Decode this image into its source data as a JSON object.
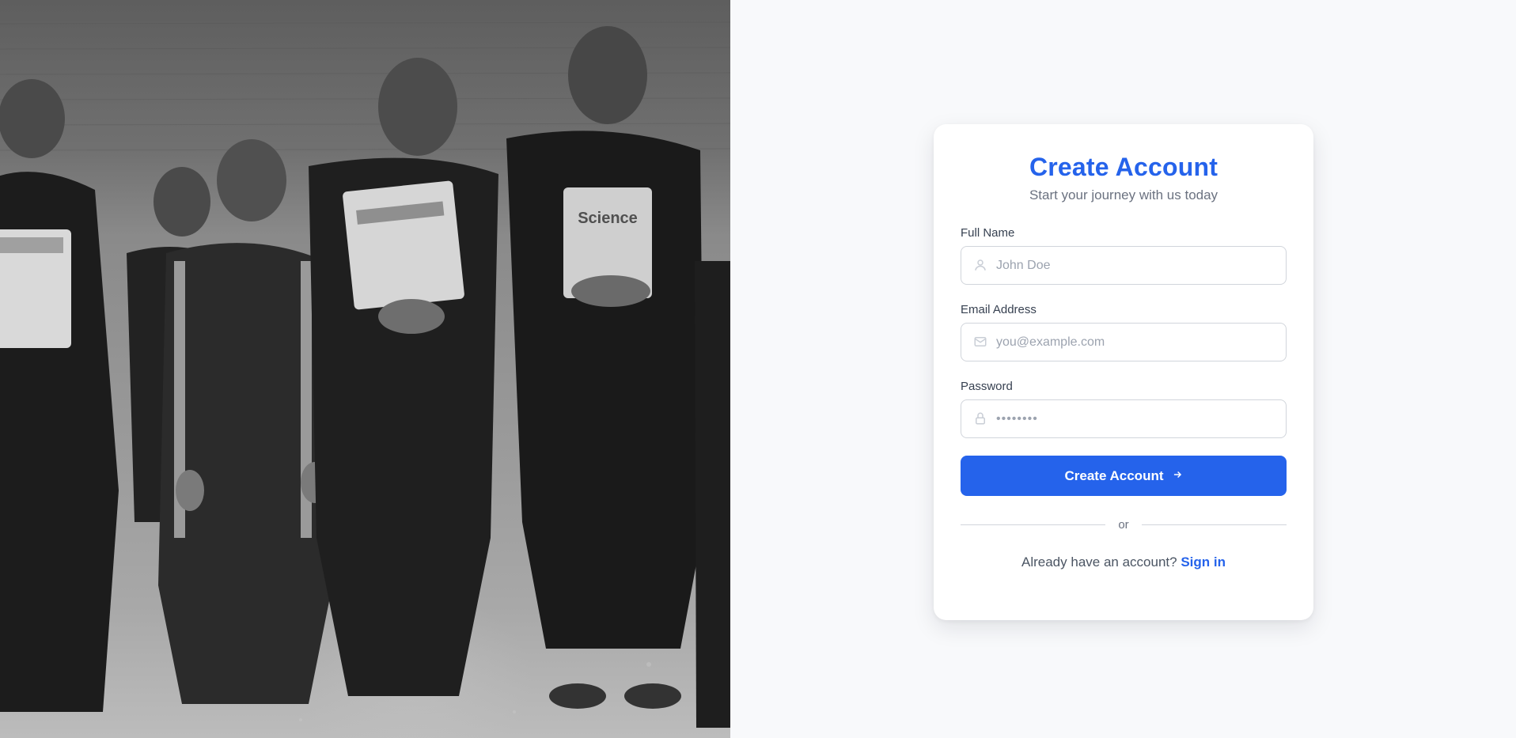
{
  "hero": {
    "image_subject": "black-and-white photograph of boys in traditional clothing holding books",
    "book_label": "Science"
  },
  "form": {
    "title": "Create Account",
    "subtitle": "Start your journey with us today",
    "fields": {
      "full_name": {
        "label": "Full Name",
        "placeholder": "John Doe",
        "icon": "user-icon"
      },
      "email": {
        "label": "Email Address",
        "placeholder": "you@example.com",
        "icon": "mail-icon"
      },
      "password": {
        "label": "Password",
        "placeholder": "••••••••",
        "icon": "lock-icon"
      }
    },
    "submit_label": "Create Account",
    "submit_icon": "arrow-right-icon",
    "divider_text": "or",
    "signin_prompt": "Already have an account?",
    "signin_link": "Sign in"
  },
  "colors": {
    "accent": "#2563eb",
    "page_bg": "#f8f9fb",
    "card_bg": "#ffffff",
    "muted_text": "#6b7280"
  }
}
